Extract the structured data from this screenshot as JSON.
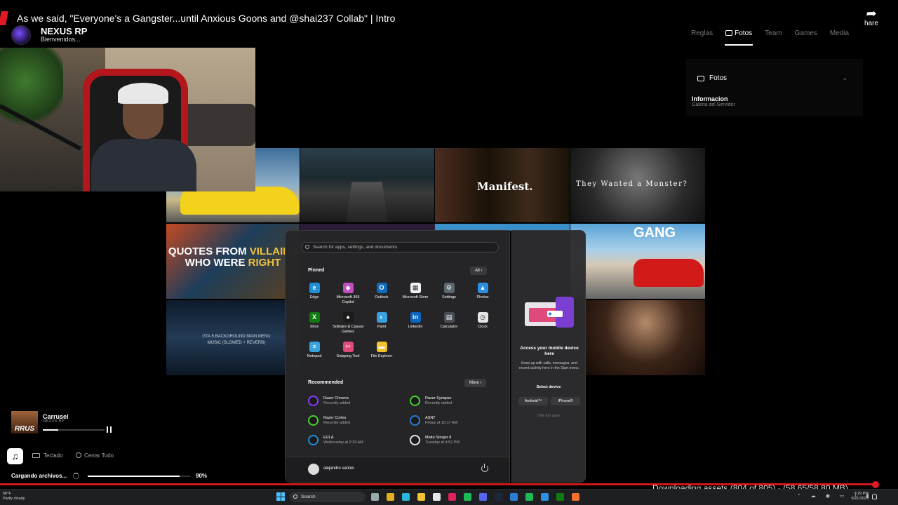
{
  "video": {
    "title": "As we said, \"Everyone's a Gangster...until Anxious Goons and @shai237 Collab\" | Intro",
    "share_label": "hare"
  },
  "server": {
    "name": "NEXUS RP",
    "subtitle": "Bienvenidos..."
  },
  "nav": {
    "items": [
      {
        "label": "Reglas",
        "active": false
      },
      {
        "label": "Fotos",
        "active": true
      },
      {
        "label": "Team",
        "active": false
      },
      {
        "label": "Games",
        "active": false
      },
      {
        "label": "Media",
        "active": false
      }
    ]
  },
  "gallery": {
    "header": "Fotos",
    "title": "Informacion",
    "subtitle": "Galeria del Servidor"
  },
  "thumbnails": {
    "t3": "Manifest.",
    "t4": "They Wanted a Monster?",
    "t5_line1_a": "QUOTES FROM ",
    "t5_line1_b": "VILLAINS",
    "t5_line2_a": "WHO WERE ",
    "t5_line2_b": "RIGHT",
    "t6": "GANG",
    "t7": "GTA 5 BACKGROUND MAIN MENU MUSIC (SLOWED + REVERB)"
  },
  "start_menu": {
    "search_placeholder": "Search for apps, settings, and documents",
    "pinned_title": "Pinned",
    "all_button": "All  ›",
    "pinned": [
      {
        "label": "Edge",
        "icon": "edge-icon",
        "color": "#1f8fd8",
        "glyph": "e"
      },
      {
        "label": "Microsoft 365 Copilot",
        "icon": "copilot-icon",
        "color": "#c04ec0",
        "glyph": "◆"
      },
      {
        "label": "Outlook",
        "icon": "outlook-icon",
        "color": "#0f6cbd",
        "glyph": "O"
      },
      {
        "label": "Microsoft Store",
        "icon": "store-icon",
        "color": "#f3f3f3",
        "glyph": "▦"
      },
      {
        "label": "Settings",
        "icon": "gear-icon",
        "color": "#5c6770",
        "glyph": "⚙"
      },
      {
        "label": "Photos",
        "icon": "photos-icon",
        "color": "#2d8fe0",
        "glyph": "▲"
      },
      {
        "label": "Xbox",
        "icon": "xbox-icon",
        "color": "#107c10",
        "glyph": "X"
      },
      {
        "label": "Solitaire & Casual Games",
        "icon": "solitaire-icon",
        "color": "#1a1a1a",
        "glyph": "♠"
      },
      {
        "label": "Paint",
        "icon": "paint-icon",
        "color": "#3aa0e0",
        "glyph": "◐"
      },
      {
        "label": "LinkedIn",
        "icon": "linkedin-icon",
        "color": "#0a66c2",
        "glyph": "in"
      },
      {
        "label": "Calculator",
        "icon": "calculator-icon",
        "color": "#4a4f57",
        "glyph": "▤"
      },
      {
        "label": "Clock",
        "icon": "clock-icon",
        "color": "#e6e6e6",
        "glyph": "◷"
      },
      {
        "label": "Notepad",
        "icon": "notepad-icon",
        "color": "#38a3dd",
        "glyph": "≡"
      },
      {
        "label": "Snipping Tool",
        "icon": "snipping-tool-icon",
        "color": "#e04a7a",
        "glyph": "✂"
      },
      {
        "label": "File Explorer",
        "icon": "folder-icon",
        "color": "#f2c230",
        "glyph": "▬"
      }
    ],
    "recommended_title": "Recommended",
    "more_button": "More  ›",
    "recommended": [
      {
        "name": "Razer Chroma",
        "sub": "Recently added",
        "icon": "razer-chroma-icon",
        "color": "#8a3cff"
      },
      {
        "name": "Razer Synapse",
        "sub": "Recently added",
        "icon": "razer-synapse-icon",
        "color": "#44d62c"
      },
      {
        "name": "Razer Cortex",
        "sub": "Recently added",
        "icon": "razer-cortex-icon",
        "color": "#44d62c"
      },
      {
        "name": "ASNT",
        "sub": "Friday at 10:17 AM",
        "icon": "document-icon",
        "color": "#2b7cd3"
      },
      {
        "name": "EULA",
        "sub": "Wednesday at 2:29 AM",
        "icon": "edge-icon",
        "color": "#1f8fd8"
      },
      {
        "name": "Matte Stinger 8",
        "sub": "Tuesday at 4:52 PM",
        "icon": "video-file-icon",
        "color": "#e6e6e6"
      }
    ],
    "user_name": "alejandro santos"
  },
  "phone_panel": {
    "title": "Access your mobile device here",
    "text": "Keep up with calls, messages, and recent activity here in the Start menu.",
    "select_label": "Select device",
    "android_label": "Android™",
    "iphone_label": "iPhone®",
    "hide_label": "Hide this pane"
  },
  "player": {
    "thumb_text": "RRUS",
    "track": "Carrusel",
    "artist": "NEXUS RP",
    "progress": 0.25,
    "keyboard_label": "Teclado",
    "close_all_label": "Cerrar Todo"
  },
  "loading": {
    "label": "Cargando archivos...",
    "percent_text": "90%",
    "progress": 0.9
  },
  "download_status": "Downloading assets (804 of 805) - (58.65/58.80 MB)",
  "taskbar": {
    "weather_temp": "66°F",
    "weather_desc": "Partly cloudy",
    "search_label": "Search",
    "time": "9:29 PM",
    "date": "9/21/2025"
  },
  "colors": {
    "accent_red": "#d3161b",
    "windows_blue": "#4cc2ff"
  }
}
